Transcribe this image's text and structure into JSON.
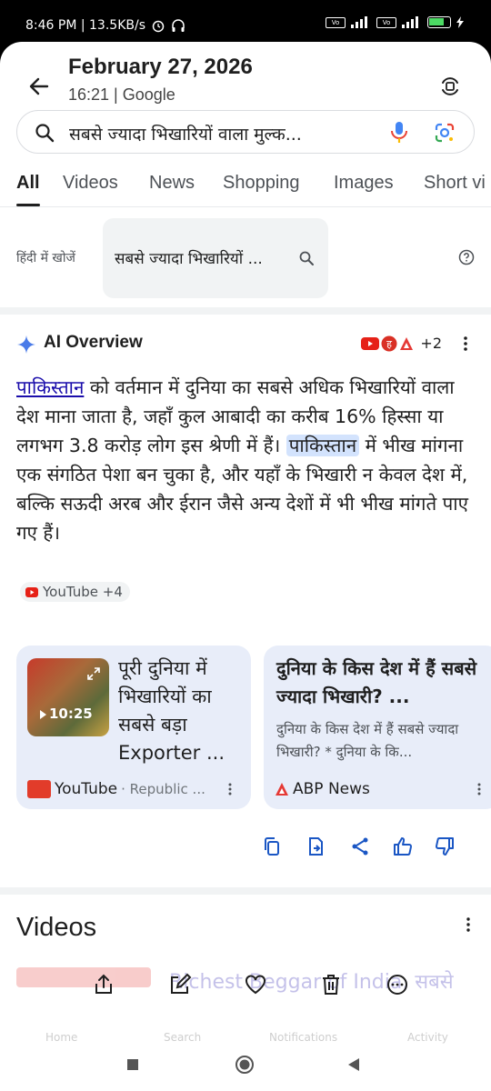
{
  "status_bar": {
    "time_speed": "8:46 PM | 13.5KB/s",
    "battery": "85"
  },
  "header": {
    "date": "February 27, 2026",
    "subtitle": "16:21 | Google"
  },
  "search": {
    "query": "सबसे ज्यादा भिखारियों वाला मुल्क..."
  },
  "tabs": [
    "All",
    "Videos",
    "News",
    "Shopping",
    "Images",
    "Short vi"
  ],
  "hindi_search": {
    "label": "हिंदी में खोजें",
    "chip_text": "सबसे ज्यादा भिखारियों ..."
  },
  "ai_overview": {
    "title": "AI Overview",
    "source_count": "+2",
    "link_word": "पाकिस्तान",
    "text_1": " को वर्तमान में दुनिया का सबसे अधिक भिखारियों वाला देश माना जाता है, जहाँ कुल आबादी का करीब 16% हिस्सा या लगभग 3.8 करोड़ लोग इस श्रेणी में हैं। ",
    "highlight_word": "पाकिस्तान",
    "text_2": " में भीख मांगना एक संगठित पेशा बन चुका है, और यहाँ के भिखारी न केवल देश में, बल्कि सऊदी अरब और ईरान जैसे अन्य देशों में भी भीख मांगते पाए गए हैं।",
    "source_chip": "YouTube +4"
  },
  "cards": [
    {
      "title": "पूरी दुनिया में भिखारियों का सबसे बड़ा Exporter ...",
      "duration": "10:25",
      "source": "YouTube",
      "meta": "· Republic ..."
    },
    {
      "title": "दुनिया के किस देश में हैं सबसे ज्यादा भिखारी? ...",
      "description": "दुनिया के किस देश में हैं सबसे ज्यादा भिखारी? * दुनिया के कि...",
      "source": "ABP News"
    }
  ],
  "videos_section": {
    "title": "Videos",
    "ghost_text": "Richest Beggar of India, सबसे"
  },
  "ghost_nav": [
    "Home",
    "Search",
    "Notifications",
    "Activity"
  ],
  "colors": {
    "link": "#1a0dab",
    "highlight": "#d3e3fd",
    "card_bg": "#e8edf9",
    "action_blue": "#1a56c4"
  }
}
